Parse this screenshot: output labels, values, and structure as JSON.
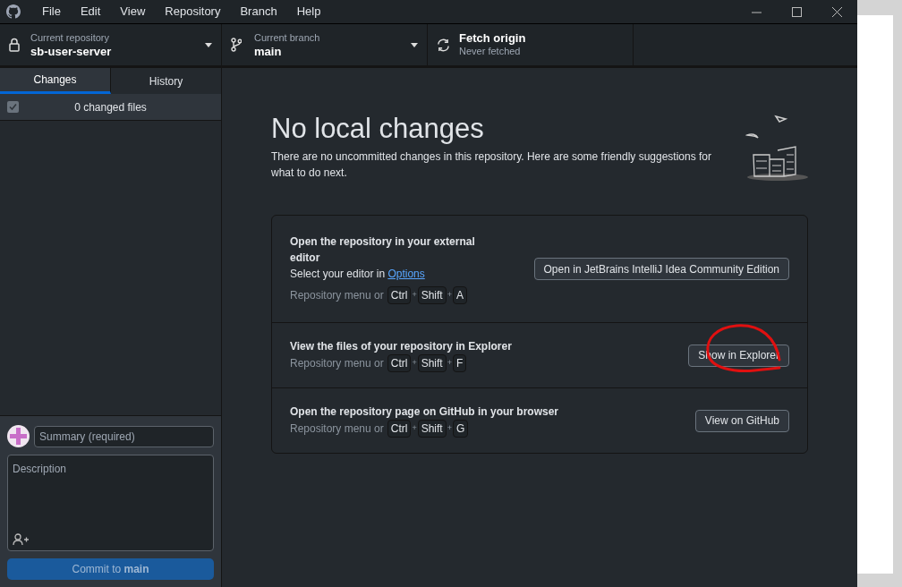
{
  "menu": [
    "File",
    "Edit",
    "View",
    "Repository",
    "Branch",
    "Help"
  ],
  "toolbar": {
    "repository": {
      "label": "Current repository",
      "value": "sb-user-server"
    },
    "branch": {
      "label": "Current branch",
      "value": "main"
    },
    "fetch": {
      "title": "Fetch origin",
      "subtitle": "Never fetched"
    }
  },
  "tabs": [
    {
      "label": "Changes",
      "selected": true
    },
    {
      "label": "History",
      "selected": false
    }
  ],
  "changes": {
    "label": "0 changed files",
    "checked": true
  },
  "commit": {
    "summary_placeholder": "Summary (required)",
    "description_placeholder": "Description",
    "button": "Commit to **main**"
  },
  "main": {
    "key_separator": "+",
    "title": "No local changes",
    "description": "There are no uncommitted changes in this repository. Here are some friendly suggestions for what to do next.",
    "suggestions": [
      {
        "title": "Open the repository in your external editor",
        "detail": "Select your editor in ",
        "link": "Options",
        "shortcut_prefix": "Repository menu or",
        "keys": [
          "Ctrl",
          "Shift",
          "A"
        ],
        "button": "Open in JetBrains IntelliJ Idea Community Edition"
      },
      {
        "title": "View the files of your repository in Explorer",
        "shortcut_prefix": "Repository menu or",
        "keys": [
          "Ctrl",
          "Shift",
          "F"
        ],
        "button": "Show in Explorer"
      },
      {
        "title": "Open the repository page on GitHub in your browser",
        "shortcut_prefix": "Repository menu or",
        "keys": [
          "Ctrl",
          "Shift",
          "G"
        ],
        "button": "View on GitHub"
      }
    ]
  }
}
